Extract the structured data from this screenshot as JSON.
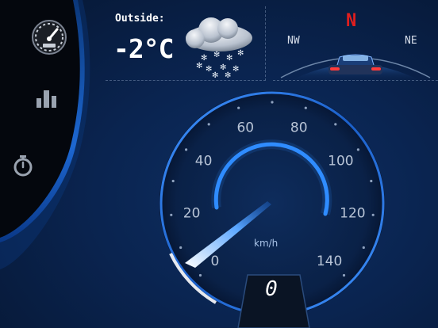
{
  "sidebar": {
    "items": [
      {
        "icon": "speedometer-icon"
      },
      {
        "icon": "bar-chart-icon"
      },
      {
        "icon": "stopwatch-icon"
      }
    ]
  },
  "weather": {
    "label": "Outside:",
    "temperature": "-2°C",
    "icon": "cloud-snow-icon"
  },
  "compass": {
    "heading": "N",
    "left": "NW",
    "right": "NE",
    "heading_color": "#e01e1e"
  },
  "speedometer": {
    "ticks": [
      "0",
      "20",
      "40",
      "60",
      "80",
      "100",
      "120",
      "140"
    ],
    "unit": "km/h",
    "speed": "0",
    "accent": "#2f8cff"
  }
}
